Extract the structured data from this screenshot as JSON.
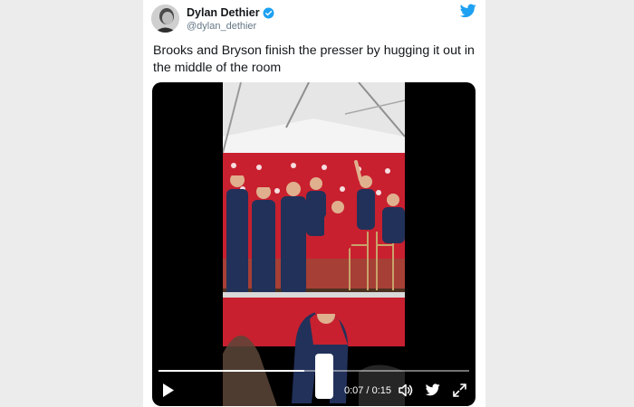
{
  "tweet": {
    "display_name": "Dylan Dethier",
    "handle": "@dylan_dethier",
    "text": "Brooks and Bryson finish the presser by hugging it out in the middle of the room",
    "verified": true
  },
  "video": {
    "elapsed": "0:07",
    "duration": "0:15",
    "time_separator": " / ",
    "progress": 0.47
  },
  "icons": {
    "verified": "verified-badge-icon",
    "twitter": "twitter-bird-icon",
    "play": "play-icon",
    "volume": "volume-icon",
    "share": "twitter-bird-icon",
    "fullscreen": "fullscreen-icon"
  },
  "colors": {
    "brand_blue": "#1da1f2",
    "backdrop_red": "#c8202f",
    "text_primary": "#14171a",
    "text_secondary": "#657786"
  }
}
